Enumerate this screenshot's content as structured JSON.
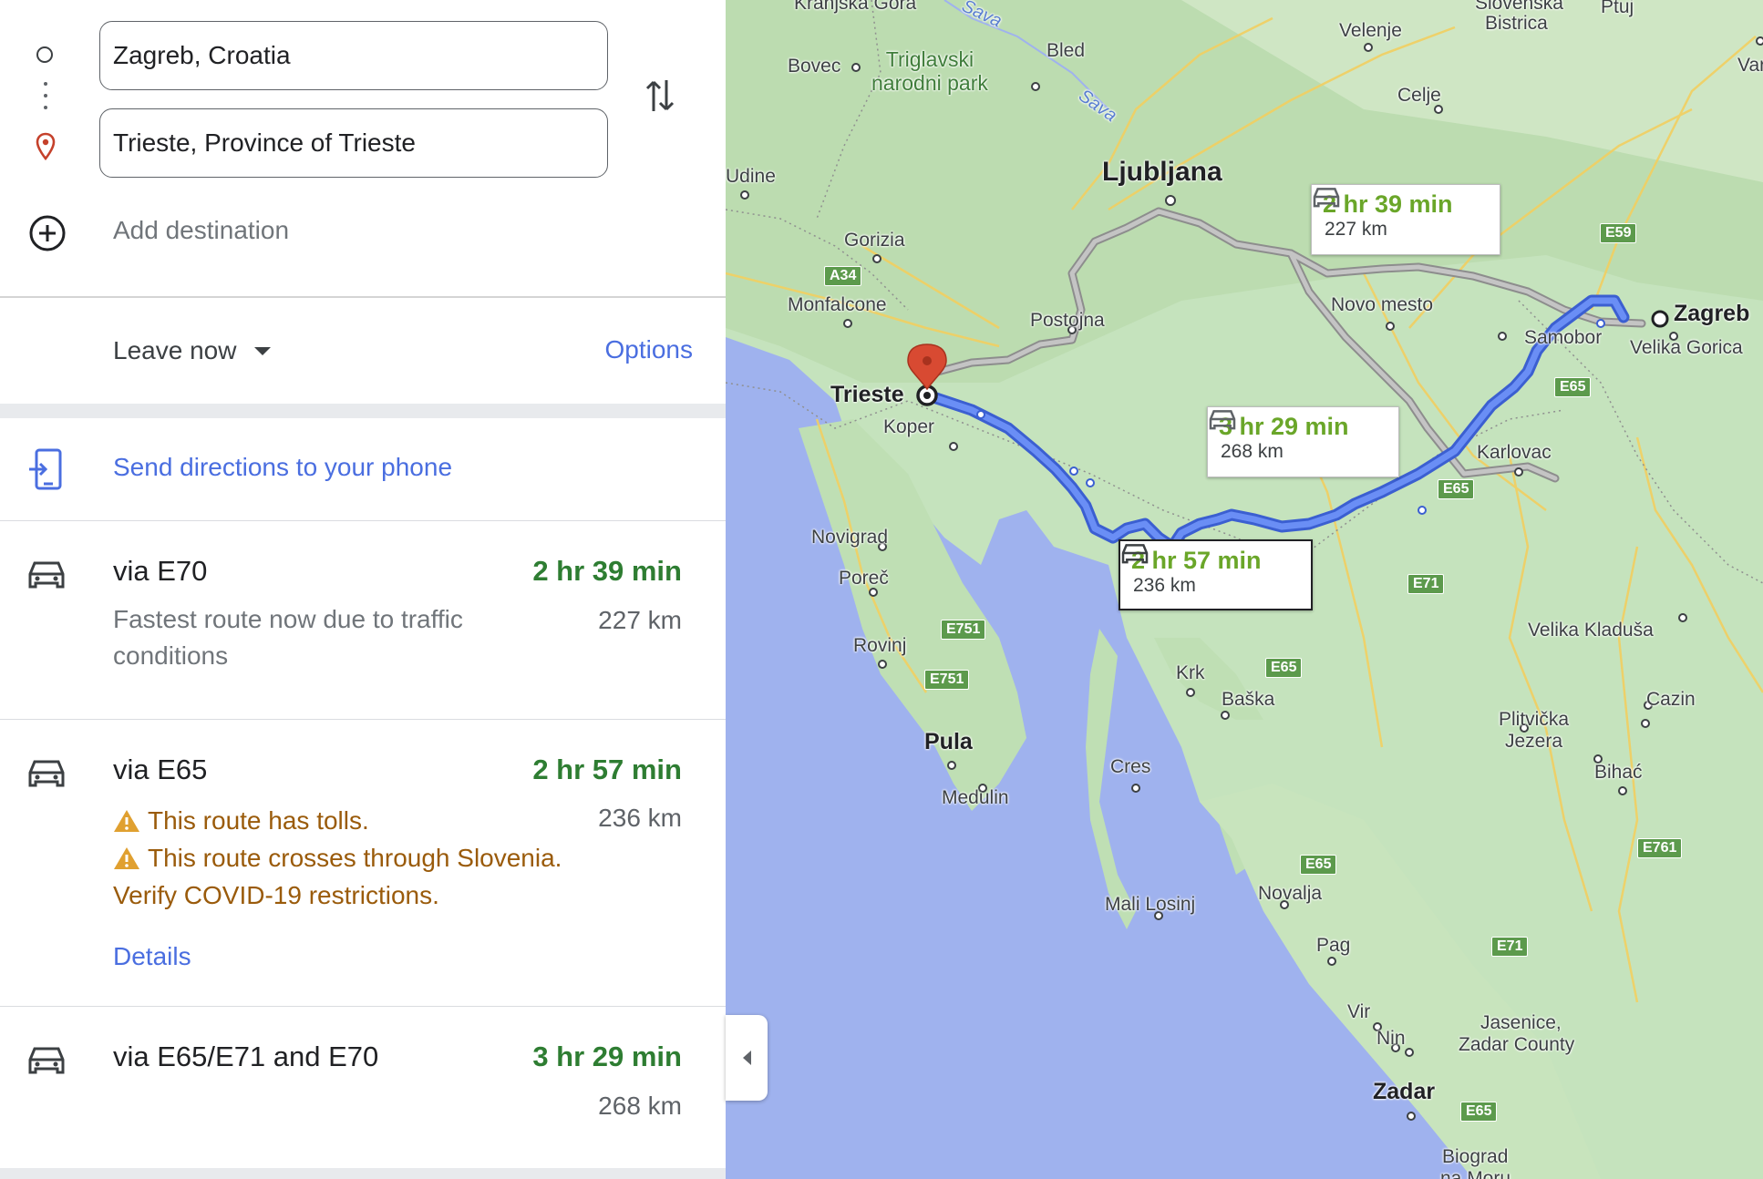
{
  "search": {
    "origin": "Zagreb, Croatia",
    "destination": "Trieste, Province of Trieste",
    "add_destination": "Add destination"
  },
  "icons": {
    "origin": "origin-circle-icon",
    "destination": "destination-pin-icon",
    "swap": "swap-arrows-icon",
    "add": "add-circle-icon",
    "phone": "send-to-phone-icon",
    "car": "car-icon",
    "warning": "warning-icon",
    "collapse": "collapse-panel-icon"
  },
  "depart": {
    "leave_now": "Leave now",
    "options": "Options"
  },
  "send_to_phone": "Send directions to your phone",
  "routes": [
    {
      "title": "via E70",
      "time": "2 hr 39 min",
      "distance": "227 km",
      "description": "Fastest route now due to traffic conditions"
    },
    {
      "title": "via E65",
      "time": "2 hr 57 min",
      "distance": "236 km",
      "warnings": [
        "This route has tolls.",
        "This route crosses through Slovenia. Verify COVID-19 restrictions."
      ],
      "details": "Details"
    },
    {
      "title": "via E65/E71 and E70",
      "time": "3 hr 29 min",
      "distance": "268 km"
    }
  ],
  "map": {
    "callouts": [
      {
        "time": "2 hr 39 min",
        "distance": "227 km"
      },
      {
        "time": "3 hr 29 min",
        "distance": "268 km"
      },
      {
        "time": "2 hr 57 min",
        "distance": "236 km"
      }
    ],
    "places": {
      "zagreb": "Zagreb",
      "trieste": "Trieste",
      "ljubljana": "Ljubljana",
      "koper": "Koper",
      "pula": "Pula",
      "medulin": "Medulin",
      "rovinj": "Rovinj",
      "porec": "Poreč",
      "novigrad": "Novigrad",
      "monfalcone": "Monfalcone",
      "gorizia": "Gorizia",
      "udine": "Udine",
      "postojna": "Postojna",
      "novo_mesto": "Novo mesto",
      "samobor": "Samobor",
      "velika_gorica": "Velika Gorica",
      "karlovac": "Karlovac",
      "celje": "Celje",
      "velenje": "Velenje",
      "bled": "Bled",
      "bovec": "Bovec",
      "krk": "Krk",
      "baska": "Baška",
      "cres": "Cres",
      "mali_losinj": "Mali Losinj",
      "novalja": "Novalja",
      "pag": "Pag",
      "vir": "Vir",
      "nin": "Nin",
      "zadar": "Zadar",
      "jasenice": "Jasenice,",
      "zadar_county": "Zadar County",
      "biograd": "Biograd",
      "biograd2": "na Moru",
      "velika_kladusa": "Velika Kladuša",
      "cazin": "Cazin",
      "bihac": "Bihać",
      "plitvicka": "Plitvička",
      "jezera": "Jezera",
      "triglav1": "Triglavski",
      "triglav2": "narodni park",
      "sava": "Sava",
      "bistrica1": "Slovenska",
      "bistrica2": "Bistrica",
      "ptuj": "Ptuj",
      "var": "Var",
      "kranjska": "Kranjska Gora"
    },
    "shields": {
      "a34": "A34",
      "e59": "E59",
      "e65a": "E65",
      "e65b": "E65",
      "e65c": "E65",
      "e65d": "E65",
      "e65e": "E65",
      "e71a": "E71",
      "e71b": "E71",
      "e751a": "E751",
      "e751b": "E751",
      "e761": "E761"
    }
  }
}
